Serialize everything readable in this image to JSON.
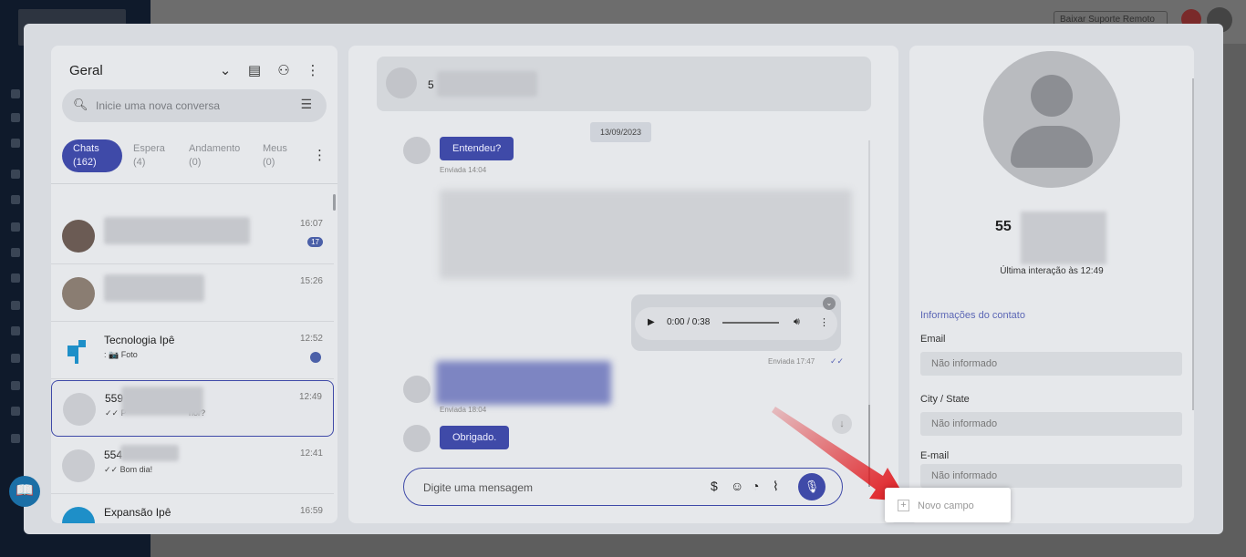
{
  "header": {
    "suporte": "Baixar Suporte Remoto"
  },
  "chat_list": {
    "title": "Geral",
    "search_placeholder": "Inicie uma nova conversa",
    "tabs": [
      {
        "label": "Chats",
        "count": "(162)"
      },
      {
        "label": "Espera",
        "count": "(4)"
      },
      {
        "label": "Andamento",
        "count": "(0)"
      },
      {
        "label": "Meus",
        "count": "(0)"
      }
    ],
    "items": [
      {
        "name": "",
        "preview": "",
        "time": "16:07",
        "badge": "17"
      },
      {
        "name": "",
        "preview": "",
        "time": "15:26"
      },
      {
        "name": "Tecnologia Ipê",
        "preview": ": 📷 Foto",
        "time": "12:52"
      },
      {
        "name": "559",
        "preview": "✓✓ P",
        "preview_end": "hor?",
        "time": "12:49"
      },
      {
        "name": "554",
        "preview": "✓✓ Bom dia!",
        "time": "12:41"
      },
      {
        "name": "Expansão Ipê",
        "preview": "",
        "time": "16:59"
      }
    ]
  },
  "conversation": {
    "contact_number": "5",
    "date_chip": "13/09/2023",
    "messages": [
      {
        "text": "Entendeu?",
        "meta": "Enviada 14:04"
      },
      {
        "audio_time": "0:00 / 0:38",
        "meta": "Enviada 17:47"
      },
      {
        "meta": "Enviada 18:04"
      },
      {
        "text": "Obrigado."
      }
    ],
    "composer_placeholder": "Digite uma mensagem"
  },
  "contact": {
    "number": "55",
    "last_interaction": "Última interação às 12:49",
    "section_title": "Informações do contato",
    "fields": [
      {
        "label": "Email",
        "value": "Não informado"
      },
      {
        "label": "City / State",
        "value": "Não informado"
      },
      {
        "label": "E-mail",
        "value": "Não informado"
      }
    ],
    "new_field": "Novo campo"
  },
  "colors": {
    "accent": "#3f4aa8",
    "arrow": "#e0161b"
  }
}
